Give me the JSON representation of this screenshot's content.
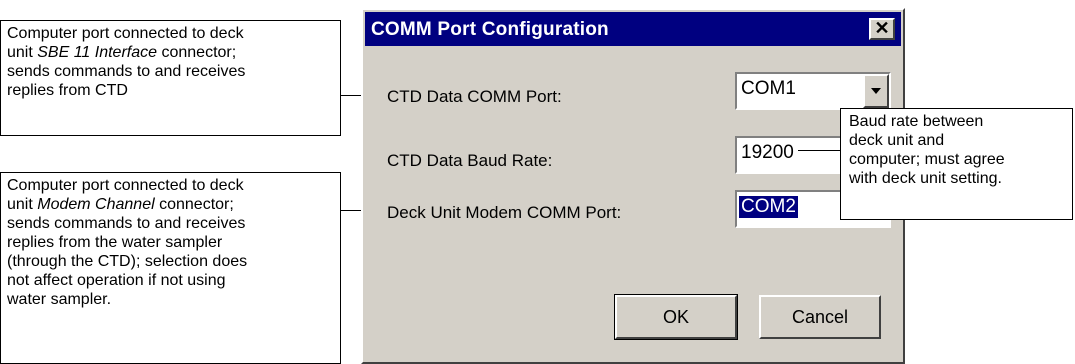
{
  "dialog": {
    "title": "COMM Port Configuration",
    "close_glyph": "✕",
    "fields": {
      "ctd_port": {
        "label": "CTD Data COMM Port:",
        "value": "COM1"
      },
      "baud_rate": {
        "label": "CTD Data Baud Rate:",
        "value": "19200"
      },
      "modem_port": {
        "label": "Deck Unit Modem COMM Port:",
        "value": "COM2"
      }
    },
    "buttons": {
      "ok": "OK",
      "cancel": "Cancel"
    }
  },
  "callouts": {
    "ctd_port": {
      "t1": "Computer port connected to deck",
      "t2a": "unit ",
      "t2b": "SBE 11 Interface",
      "t2c": " connector;",
      "t3": "sends commands to and receives",
      "t4": "replies from CTD"
    },
    "modem_port": {
      "t1": "Computer port connected to deck",
      "t2a": "unit ",
      "t2b": "Modem Channel",
      "t2c": " connector;",
      "t3": "sends commands to and receives",
      "t4": "replies from the water sampler",
      "t5": "(through the CTD); selection does",
      "t6": "not affect operation if not using",
      "t7": "water sampler."
    },
    "baud": {
      "t1": "Baud rate between",
      "t2": "deck unit and",
      "t3": "computer; must agree",
      "t4": "with deck unit setting."
    }
  }
}
